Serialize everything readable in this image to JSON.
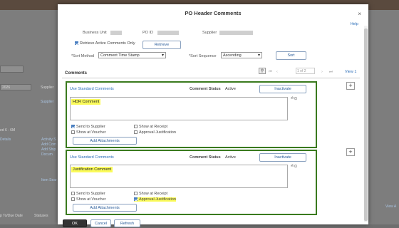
{
  "modal": {
    "title": "PO Header Comments",
    "close": "×",
    "help": "Help"
  },
  "fields": {
    "business_unit_label": "Business Unit",
    "po_id_label": "PO ID",
    "supplier_label": "Supplier",
    "retrieve_active_label": "Retrieve Active Comments Only",
    "retrieve_button": "Retrieve",
    "sort_method_label": "*Sort Method",
    "sort_method_value": "Comment Time Stamp",
    "sort_sequence_label": "*Sort Sequence",
    "sort_sequence_value": "Ascending",
    "sort_button": "Sort"
  },
  "comments_grid": {
    "title": "Comments",
    "pager_text": "1 of 2",
    "view_all": "View 1"
  },
  "comment_cards": [
    {
      "use_standard": "Use Standard Comments",
      "status_label": "Comment Status",
      "status_value": "Active",
      "action_button": "Inactivate",
      "text": "HDR Comment",
      "send_to_supplier": "Send to Supplier",
      "show_at_receipt": "Show at Receipt",
      "show_at_voucher": "Show at Voucher",
      "approval_justification": "Approval Justification",
      "add_attachments": "Add Attachments"
    },
    {
      "use_standard": "Use Standard Comments",
      "status_label": "Comment Status",
      "status_value": "Active",
      "action_button": "Inactivate",
      "text": "Justification Comment",
      "send_to_supplier": "Send to Supplier",
      "show_at_receipt": "Show at Receipt",
      "show_at_voucher": "Show at Voucher",
      "approval_justification": "Approval Justification",
      "add_attachments": "Add Attachments"
    }
  ],
  "footer": {
    "ok": "OK",
    "cancel": "Cancel",
    "refresh": "Refresh"
  },
  "background": {
    "date_value": "2026",
    "supplier_label": "Supplier",
    "supplier_link": "Supplier",
    "time_text": "ed 6 - 6M",
    "details": "Details",
    "activity_s": "Activity S",
    "add_com": "Add Com",
    "add_ship": "Add Ship",
    "docum": "Docum",
    "item_sear": "Item Sear",
    "due_date": "p To/Due Date",
    "statuses": "Statuses",
    "view_a": "View A",
    "colors": {
      "accent_link": "#2a6db8",
      "card_border": "#3a7a1e",
      "highlight": "#fbfb5a"
    }
  }
}
